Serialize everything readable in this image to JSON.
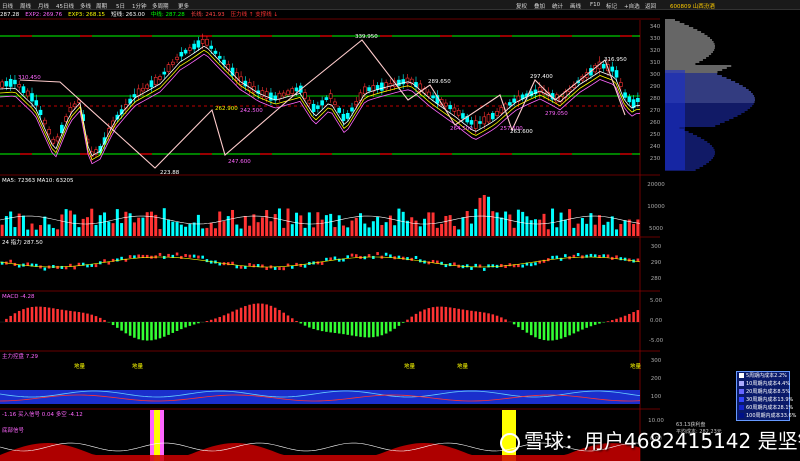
{
  "toolbar": {
    "items": [
      "日线",
      "周线",
      "月线",
      "45日线",
      "多线",
      "周期",
      "5日",
      "1分钟",
      "多周期",
      "更多"
    ],
    "right_items": [
      "复权",
      "叠加",
      "统计",
      "画线",
      "F10",
      "标记",
      "+自选",
      "返回"
    ],
    "stock_code": "600809 山西汾酒"
  },
  "main_panel": {
    "indicators": [
      {
        "text": "287.28",
        "color": "#ffffff"
      },
      {
        "text": "EXP2: 269.76",
        "color": "#ff66ff"
      },
      {
        "text": "EXP3: 268.15",
        "color": "#ffff00"
      },
      {
        "text": "短线: 263.00",
        "color": "#ffffff"
      },
      {
        "text": "中线: 287.28",
        "color": "#00ff00"
      },
      {
        "text": "长线: 241.93",
        "color": "#ff4444"
      },
      {
        "text": "压力线 ↑ 支撑线 ↓",
        "color": "#ff3333"
      }
    ],
    "y_labels": [
      "340",
      "330",
      "320",
      "310",
      "300",
      "290",
      "280",
      "270",
      "260",
      "250",
      "240",
      "230"
    ],
    "price_annotations": [
      {
        "text": "310.450",
        "color": "#ff66ff"
      },
      {
        "text": "339.950",
        "color": "#ffffff"
      },
      {
        "text": "289.650",
        "color": "#ffffff"
      },
      {
        "text": "297.400",
        "color": "#ffffff"
      },
      {
        "text": "262.900",
        "color": "#ffff00"
      },
      {
        "text": "242.500",
        "color": "#ff66ff"
      },
      {
        "text": "223.88",
        "color": "#ffffff"
      },
      {
        "text": "247.600",
        "color": "#ff66ff"
      },
      {
        "text": "264.500",
        "color": "#ff66ff"
      },
      {
        "text": "257.500",
        "color": "#ff66ff"
      },
      {
        "text": "263.600",
        "color": "#ffffff"
      },
      {
        "text": "279.050",
        "color": "#ff66ff"
      },
      {
        "text": "316.950",
        "color": "#ffffff"
      }
    ]
  },
  "volume_panel": {
    "header": "MA5: 72363  MA10: 63205",
    "y_labels": [
      "20000",
      "10000",
      "5000"
    ]
  },
  "panel3": {
    "header": "24 指力 287.50",
    "y_labels": [
      "300",
      "290",
      "280"
    ]
  },
  "macd_panel": {
    "header": "MACD -4.28",
    "y_labels": [
      "5.00",
      "0.00",
      "-5.00"
    ]
  },
  "panel5": {
    "header": "主力控盘 7.29",
    "markers": [
      "地量",
      "地量",
      "地量",
      "地量",
      "地量"
    ],
    "y_labels": [
      "300",
      "200",
      "100"
    ]
  },
  "bottom_panel": {
    "header": "-1.16  买入信号 0.04  多空 -4.12",
    "signal_label": "底部信号",
    "y_labels": [
      "10.00",
      "0.00"
    ]
  },
  "cost_legend": [
    {
      "label": "5周期内成本2.2%",
      "color": "#ffffff"
    },
    {
      "label": "10周期内成本4.4%",
      "color": "#aaaaff"
    },
    {
      "label": "20周期内成本8.5%",
      "color": "#6666ff"
    },
    {
      "label": "30周期内成本13.9%",
      "color": "#3344ff"
    },
    {
      "label": "60周期内成本28.1%",
      "color": "#1122cc"
    },
    {
      "label": "100周期内成本33.6%",
      "color": "#001188"
    }
  ],
  "side_info": [
    "63.13获利盘",
    "平均成本: 282.23元"
  ],
  "watermark": {
    "text": "雪球：用户4682415142",
    "suffix": "是坚锡"
  }
}
